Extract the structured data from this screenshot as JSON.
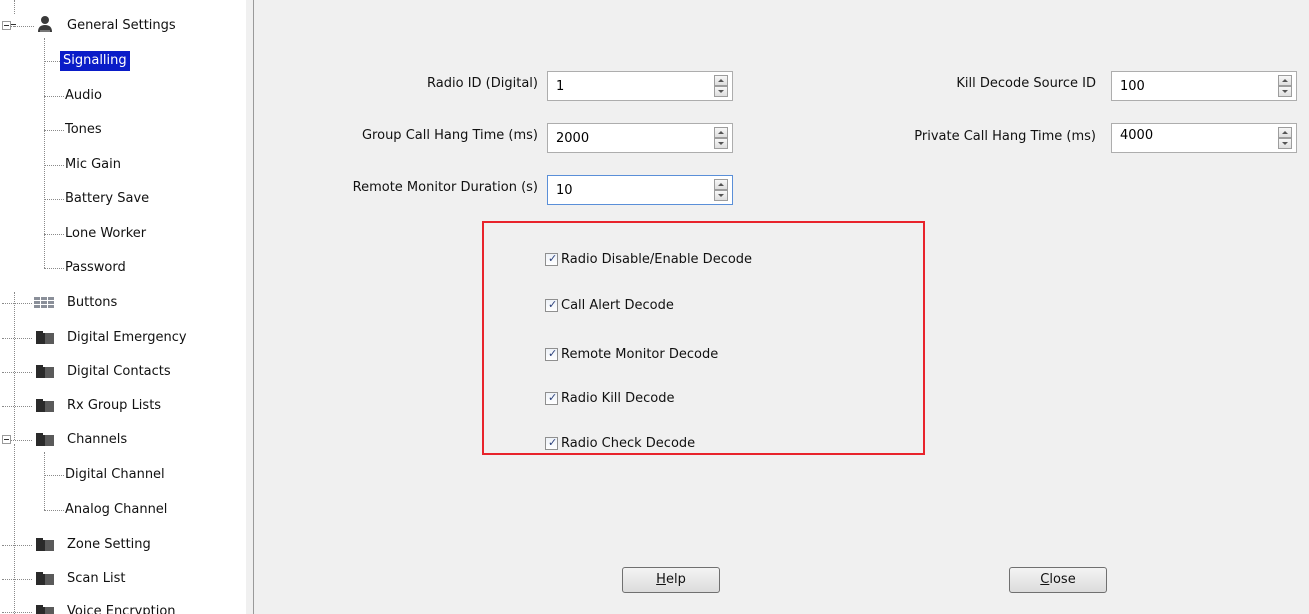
{
  "tree": {
    "items": [
      {
        "label": "General Settings",
        "icon": "person-icon"
      },
      {
        "label": "Signalling",
        "selected": true
      },
      {
        "label": "Audio"
      },
      {
        "label": "Tones"
      },
      {
        "label": "Mic Gain"
      },
      {
        "label": "Battery Save"
      },
      {
        "label": "Lone Worker"
      },
      {
        "label": "Password"
      },
      {
        "label": "Buttons",
        "icon": "buttons-icon"
      },
      {
        "label": "Digital Emergency",
        "icon": "folder-icon"
      },
      {
        "label": "Digital Contacts",
        "icon": "folder-icon"
      },
      {
        "label": "Rx Group Lists",
        "icon": "folder-icon"
      },
      {
        "label": "Channels",
        "icon": "folder-icon"
      },
      {
        "label": "Digital Channel"
      },
      {
        "label": "Analog Channel"
      },
      {
        "label": "Zone Setting",
        "icon": "folder-icon"
      },
      {
        "label": "Scan List",
        "icon": "folder-icon"
      },
      {
        "label": "Voice Encryption",
        "icon": "folder-icon"
      }
    ]
  },
  "fields": {
    "radio_id": {
      "label": "Radio ID (Digital)",
      "value": "1"
    },
    "group_call_hang_time": {
      "label": "Group Call Hang Time (ms)",
      "value": "2000"
    },
    "remote_monitor_duration": {
      "label": "Remote Monitor Duration (s)",
      "value": "10"
    },
    "kill_decode_source_id": {
      "label": "Kill Decode Source ID",
      "value": "100"
    },
    "private_call_hang_time": {
      "label": "Private Call Hang Time (ms)",
      "value": "4000"
    }
  },
  "checkboxes": {
    "radio_disable_enable_decode": {
      "label": "Radio Disable/Enable Decode",
      "checked": true
    },
    "call_alert_decode": {
      "label": "Call Alert Decode",
      "checked": true
    },
    "remote_monitor_decode": {
      "label": "Remote Monitor Decode",
      "checked": true
    },
    "radio_kill_decode": {
      "label": "Radio Kill Decode",
      "checked": true
    },
    "radio_check_decode": {
      "label": "Radio Check Decode",
      "checked": true
    }
  },
  "buttons": {
    "help": {
      "mnemonic": "H",
      "rest": "elp"
    },
    "close": {
      "mnemonic": "C",
      "rest": "lose"
    }
  },
  "colors": {
    "selection": "#0a1cc8",
    "highlight_box": "#e8232b",
    "panel_background": "#f0f0f0"
  }
}
